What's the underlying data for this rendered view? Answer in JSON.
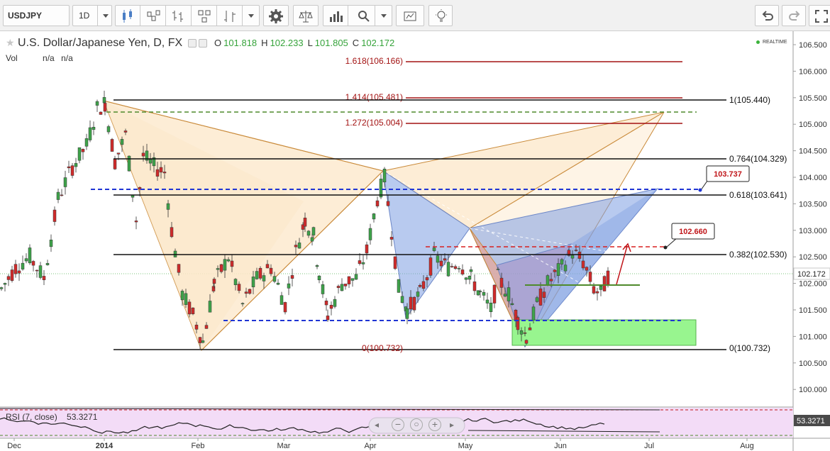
{
  "toolbar": {
    "symbol": "USDJPY",
    "interval": "1D"
  },
  "chart": {
    "title": "U.S. Dollar/Japanese Yen, D, FX",
    "ohlc": {
      "o_label": "O",
      "o": "101.818",
      "h_label": "H",
      "h": "102.233",
      "l_label": "L",
      "l": "101.805",
      "c_label": "C",
      "c": "102.172"
    },
    "vol_label": "Vol",
    "vol_values": [
      "n/a",
      "n/a"
    ],
    "realtime": "REALTIME",
    "current_price": "102.172",
    "price_axis": [
      "106.500",
      "106.000",
      "105.500",
      "105.000",
      "104.500",
      "104.000",
      "103.500",
      "103.000",
      "102.500",
      "102.000",
      "101.500",
      "101.000",
      "100.500",
      "100.000"
    ],
    "time_axis": [
      "Dec",
      "2014",
      "Feb",
      "Mar",
      "Apr",
      "May",
      "Jun",
      "Jul",
      "Aug"
    ],
    "fib_right": [
      "1(105.440)",
      "0.764(104.329)",
      "0.618(103.641)",
      "0.382(102.530)",
      "0(100.732)"
    ],
    "fib_ext": [
      "1.618(106.166)",
      "1.414(105.481)",
      "1.272(105.004)"
    ],
    "fib_zero_inner": "0(100.732)",
    "callout_1": "103.737",
    "callout_2": "102.660"
  },
  "rsi": {
    "label": "RSI (7, close)",
    "value": "53.3271",
    "axis_value": "53.3271"
  },
  "colors": {
    "up": "#3ea34a",
    "down": "#d02b2b",
    "fib_ext": "#a31212",
    "fib_level": "#111111",
    "blue_dash": "#1f35d4",
    "green_dash": "#4f8a2c",
    "pattern_fill": "#fce7c8",
    "pattern_blue": "#7d9ee2",
    "target_box": "#98f58f"
  }
}
